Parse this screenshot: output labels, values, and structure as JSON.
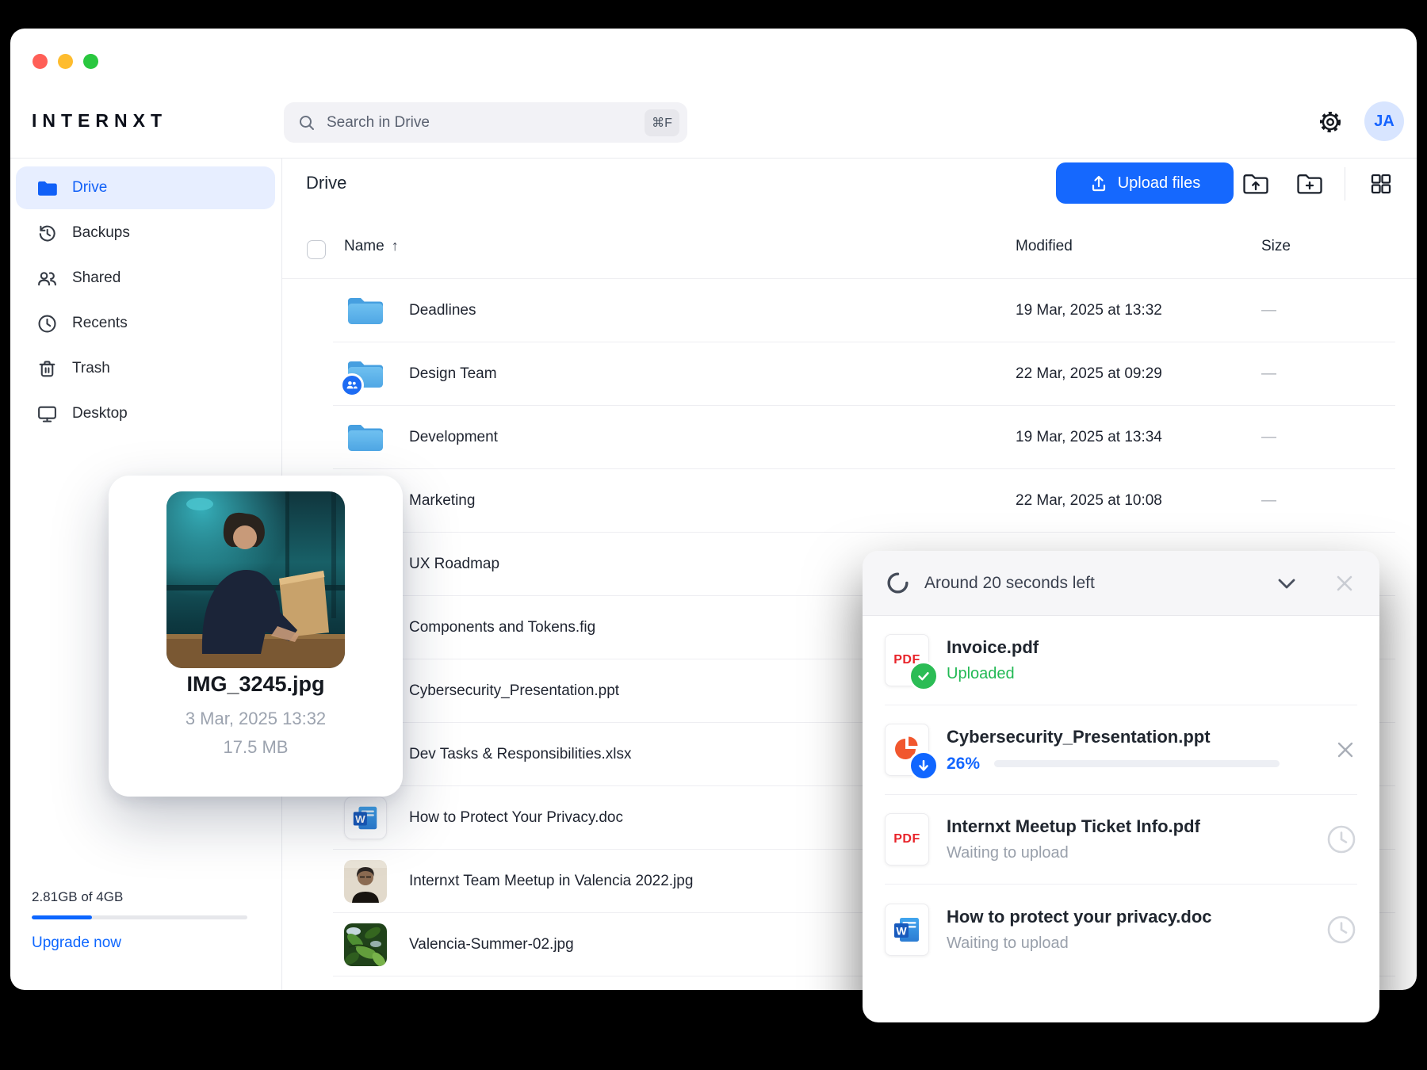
{
  "app": {
    "logo": "INTERNXT",
    "avatar_initials": "JA"
  },
  "colors": {
    "accent": "#1066FF",
    "success_green": "#2BBC55",
    "pdf_red": "#E8232A",
    "ppt_orange": "#F1572E",
    "word_blue": "#185ABD",
    "folder_blue": "#55ADE8"
  },
  "search": {
    "placeholder": "Search in Drive",
    "shortcut": "⌘F"
  },
  "sidebar": {
    "items": [
      {
        "label": "Drive",
        "icon": "drive",
        "selected": true
      },
      {
        "label": "Backups",
        "icon": "backups",
        "selected": false
      },
      {
        "label": "Shared",
        "icon": "shared",
        "selected": false
      },
      {
        "label": "Recents",
        "icon": "recents",
        "selected": false
      },
      {
        "label": "Trash",
        "icon": "trash",
        "selected": false
      },
      {
        "label": "Desktop",
        "icon": "desktop",
        "selected": false
      }
    ],
    "storage": {
      "usage": "2.81GB of 4GB",
      "percent_used": 28,
      "upgrade_label": "Upgrade now"
    }
  },
  "content": {
    "title": "Drive",
    "upload_button": "Upload files",
    "columns": {
      "name": "Name",
      "sort_arrow": "↑",
      "modified": "Modified",
      "size": "Size"
    },
    "rows": [
      {
        "name": "Deadlines",
        "icon": "folder",
        "modified": "19 Mar, 2025 at 13:32",
        "size": "—"
      },
      {
        "name": "Design Team",
        "icon": "folder-shared",
        "modified": "22 Mar, 2025 at 09:29",
        "size": "—"
      },
      {
        "name": "Development",
        "icon": "folder",
        "modified": "19 Mar, 2025 at 13:34",
        "size": "—"
      },
      {
        "name": "Marketing",
        "icon": "hidden",
        "modified": "22 Mar, 2025 at 10:08",
        "size": "—"
      },
      {
        "name": "UX Roadmap",
        "icon": "hidden",
        "modified": "",
        "size": ""
      },
      {
        "name": "Components and Tokens.fig",
        "icon": "hidden",
        "modified": "",
        "size": ""
      },
      {
        "name": "Cybersecurity_Presentation.ppt",
        "icon": "hidden",
        "modified": "",
        "size": ""
      },
      {
        "name": "Dev Tasks & Responsibilities.xlsx",
        "icon": "hidden",
        "modified": "",
        "size": ""
      },
      {
        "name": "How to Protect Your Privacy.doc",
        "icon": "word",
        "modified": "",
        "size": ""
      },
      {
        "name": "Internxt Team Meetup in Valencia 2022.jpg",
        "icon": "img-person",
        "modified": "",
        "size": ""
      },
      {
        "name": "Valencia-Summer-02.jpg",
        "icon": "img-leaves",
        "modified": "",
        "size": ""
      }
    ]
  },
  "preview_card": {
    "filename": "IMG_3245.jpg",
    "date": "3 Mar, 2025 13:32",
    "size": "17.5 MB"
  },
  "upload_panel": {
    "title": "Around 20 seconds left",
    "items": [
      {
        "name": "Invoice.pdf",
        "icon": "pdf",
        "badge": "check",
        "status": "Uploaded",
        "status_type": "success",
        "trailing": "none"
      },
      {
        "name": "Cybersecurity_Presentation.ppt",
        "icon": "ppt",
        "badge": "arrow",
        "status": "26%",
        "status_type": "progress",
        "progress_percent": 26,
        "trailing": "close"
      },
      {
        "name": "Internxt Meetup Ticket Info.pdf",
        "icon": "pdf",
        "badge": "",
        "status": "Waiting to upload",
        "status_type": "waiting",
        "trailing": "clock"
      },
      {
        "name": "How to protect your privacy.doc",
        "icon": "word",
        "badge": "",
        "status": "Waiting to upload",
        "status_type": "waiting",
        "trailing": "clock"
      }
    ]
  }
}
